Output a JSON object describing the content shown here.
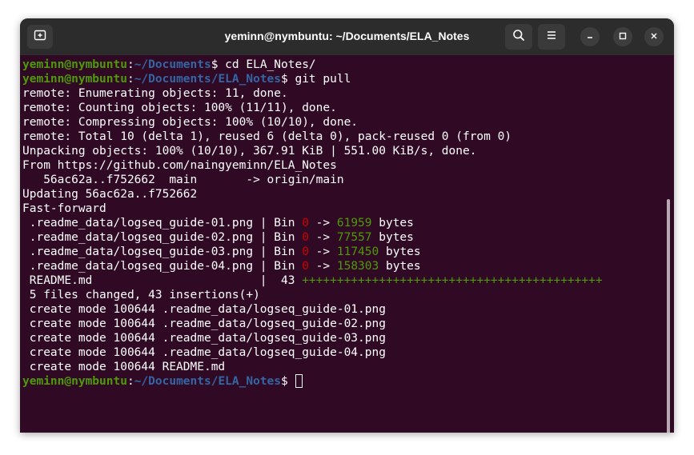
{
  "window": {
    "title": "yeminn@nymbuntu: ~/Documents/ELA_Notes"
  },
  "titlebar": {
    "new_tab_icon": "new-tab-icon",
    "search_icon": "search-icon",
    "menu_icon": "hamburger-menu-icon",
    "minimize_icon": "minimize-icon",
    "maximize_icon": "maximize-icon",
    "close_icon": "close-icon"
  },
  "colors": {
    "terminal_bg": "#300a24",
    "titlebar_bg": "#2c2c2c",
    "prompt_user": "#4e9a06",
    "prompt_path": "#3465a4",
    "deletions": "#cc0000",
    "insertions": "#4e9a06"
  },
  "terminal": {
    "lines": [
      [
        {
          "t": "yeminn@nymbuntu",
          "c": "user"
        },
        {
          "t": ":"
        },
        {
          "t": "~/Documents",
          "c": "path"
        },
        {
          "t": "$ cd ELA_Notes/"
        }
      ],
      [
        {
          "t": "yeminn@nymbuntu",
          "c": "user"
        },
        {
          "t": ":"
        },
        {
          "t": "~/Documents/ELA_Notes",
          "c": "path"
        },
        {
          "t": "$ git pull"
        }
      ],
      [
        {
          "t": "remote: Enumerating objects: 11, done."
        }
      ],
      [
        {
          "t": "remote: Counting objects: 100% (11/11), done."
        }
      ],
      [
        {
          "t": "remote: Compressing objects: 100% (10/10), done."
        }
      ],
      [
        {
          "t": "remote: Total 10 (delta 1), reused 6 (delta 0), pack-reused 0 (from 0)"
        }
      ],
      [
        {
          "t": "Unpacking objects: 100% (10/10), 367.91 KiB | 551.00 KiB/s, done."
        }
      ],
      [
        {
          "t": "From https://github.com/naingyeminn/ELA_Notes"
        }
      ],
      [
        {
          "t": "   56ac62a..f752662  main       -> origin/main"
        }
      ],
      [
        {
          "t": "Updating 56ac62a..f752662"
        }
      ],
      [
        {
          "t": "Fast-forward"
        }
      ],
      [
        {
          "t": " .readme_data/logseq_guide-01.png | Bin "
        },
        {
          "t": "0",
          "c": "red"
        },
        {
          "t": " -> "
        },
        {
          "t": "61959",
          "c": "green"
        },
        {
          "t": " bytes"
        }
      ],
      [
        {
          "t": " .readme_data/logseq_guide-02.png | Bin "
        },
        {
          "t": "0",
          "c": "red"
        },
        {
          "t": " -> "
        },
        {
          "t": "77557",
          "c": "green"
        },
        {
          "t": " bytes"
        }
      ],
      [
        {
          "t": " .readme_data/logseq_guide-03.png | Bin "
        },
        {
          "t": "0",
          "c": "red"
        },
        {
          "t": " -> "
        },
        {
          "t": "117450",
          "c": "green"
        },
        {
          "t": " bytes"
        }
      ],
      [
        {
          "t": " .readme_data/logseq_guide-04.png | Bin "
        },
        {
          "t": "0",
          "c": "red"
        },
        {
          "t": " -> "
        },
        {
          "t": "158303",
          "c": "green"
        },
        {
          "t": " bytes"
        }
      ],
      [
        {
          "t": " README.md                        |  43 "
        },
        {
          "t": "+++++++++++++++++++++++++++++++++++++++++++",
          "c": "green"
        }
      ],
      [
        {
          "t": " 5 files changed, 43 insertions(+)"
        }
      ],
      [
        {
          "t": " create mode 100644 .readme_data/logseq_guide-01.png"
        }
      ],
      [
        {
          "t": " create mode 100644 .readme_data/logseq_guide-02.png"
        }
      ],
      [
        {
          "t": " create mode 100644 .readme_data/logseq_guide-03.png"
        }
      ],
      [
        {
          "t": " create mode 100644 .readme_data/logseq_guide-04.png"
        }
      ],
      [
        {
          "t": " create mode 100644 README.md"
        }
      ],
      [
        {
          "t": "yeminn@nymbuntu",
          "c": "user"
        },
        {
          "t": ":"
        },
        {
          "t": "~/Documents/ELA_Notes",
          "c": "path"
        },
        {
          "t": "$ "
        },
        {
          "t": "",
          "c": "cursor"
        }
      ]
    ]
  }
}
